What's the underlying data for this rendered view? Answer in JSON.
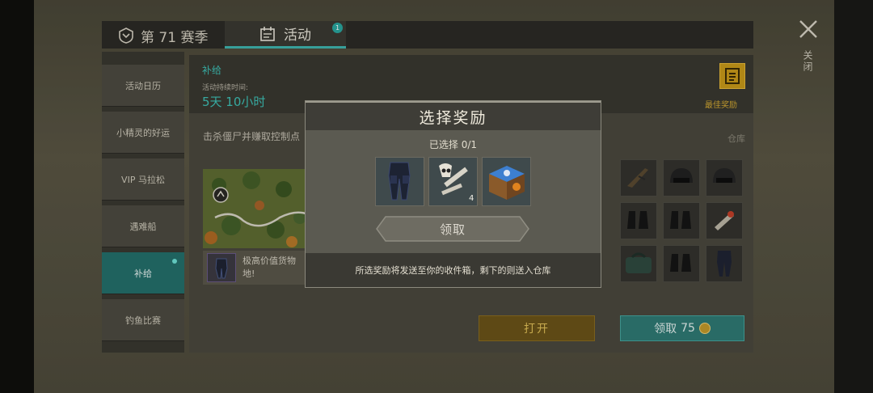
{
  "top_tabs": {
    "season_label": "第 71 赛季",
    "activity_label": "活动",
    "activity_badge": "1"
  },
  "close": {
    "label": "关闭"
  },
  "menu": {
    "items": [
      {
        "label": "活动日历"
      },
      {
        "label": "小精灵的好运"
      },
      {
        "label": "VIP 马拉松"
      },
      {
        "label": "遇难船"
      },
      {
        "label": "补给"
      },
      {
        "label": "钓鱼比赛"
      }
    ],
    "active_index": 4
  },
  "event": {
    "title": "补给",
    "duration_label": "活动持续时间:",
    "duration_value": "5天 10小时",
    "best_reward_label": "最佳奖励",
    "description": "击杀僵尸并赚取控制点",
    "warehouse_label": "仓库",
    "item_info": "极高价值货物地!",
    "open_button": "打开",
    "claim_button": "领取",
    "claim_cost": "75"
  },
  "modal": {
    "title": "选择奖励",
    "selected_count": "已选择 0/1",
    "rewards": [
      {
        "icon": "armored-pants-icon"
      },
      {
        "icon": "skull-pipe-parts-icon",
        "quantity": "4"
      },
      {
        "icon": "blue-crate-icon"
      }
    ],
    "receive_button": "领取",
    "footer_note": "所选奖励将发送至你的收件箱，剩下的则送入仓库"
  },
  "colors": {
    "accent_teal": "#3fc1b7",
    "gold": "#c99a1a"
  }
}
